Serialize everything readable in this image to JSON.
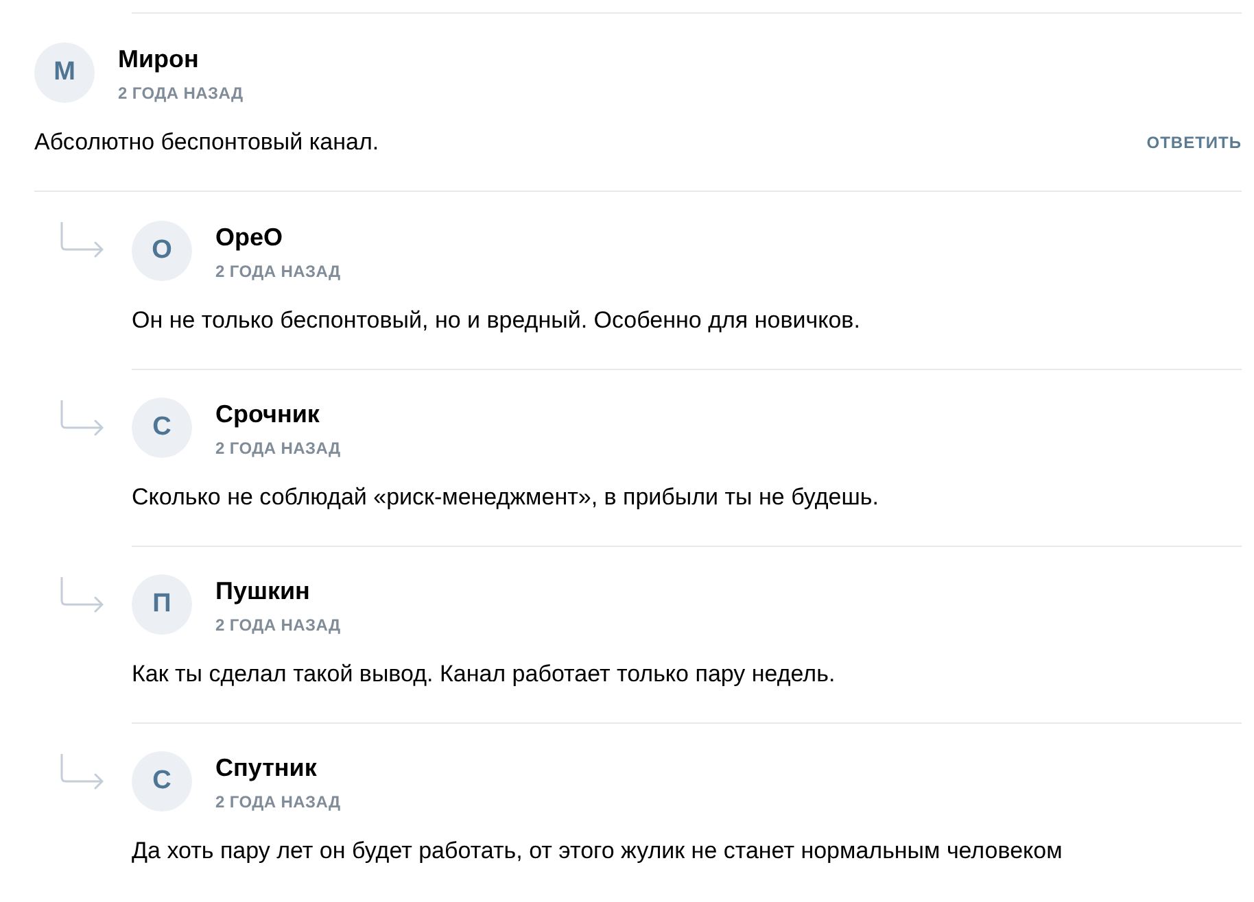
{
  "comment": {
    "author": "Мирон",
    "avatar": "М",
    "time": "2 ГОДА НАЗАД",
    "text": "Абсолютно беспонтовый канал.",
    "reply_action": "ОТВЕТИТЬ",
    "replies": [
      {
        "author": "ОреО",
        "avatar": "О",
        "time": "2 ГОДА НАЗАД",
        "text": "Он не только беспонтовый, но и вредный. Особенно для новичков."
      },
      {
        "author": "Срочник",
        "avatar": "С",
        "time": "2 ГОДА НАЗАД",
        "text": "Сколько не соблюдай «риск-менеджмент», в прибыли ты не будешь."
      },
      {
        "author": "Пушкин",
        "avatar": "П",
        "time": "2 ГОДА НАЗАД",
        "text": "Как ты сделал такой вывод. Канал работает только пару недель."
      },
      {
        "author": "Спутник",
        "avatar": "С",
        "time": "2 ГОДА НАЗАД",
        "text": "Да хоть пару лет он будет работать, от этого жулик не станет нормальным человеком"
      }
    ]
  }
}
